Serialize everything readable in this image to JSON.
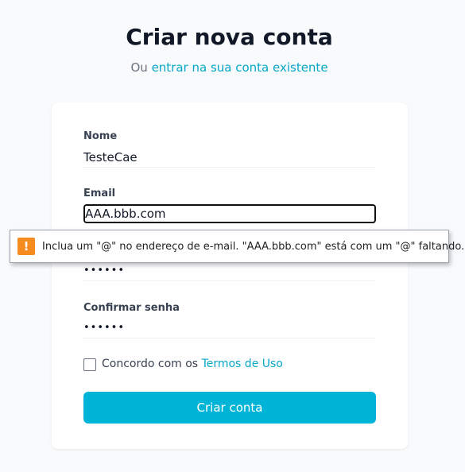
{
  "header": {
    "title": "Criar nova conta",
    "subtitle_prefix": "Ou",
    "subtitle_link": "entrar na sua conta existente"
  },
  "form": {
    "name_label": "Nome",
    "name_value": "TesteCae",
    "email_label": "Email",
    "email_value": "AAA.bbb.com",
    "password_value": "••••••",
    "confirm_label": "Confirmar senha",
    "confirm_value": "••••••",
    "terms_prefix": "Concordo com os",
    "terms_link": "Termos de Uso",
    "terms_checked": false,
    "submit_label": "Criar conta"
  },
  "validation": {
    "icon": "warning-icon",
    "icon_glyph": "!",
    "message": "Inclua um \"@\" no endereço de e-mail. \"AAA.bbb.com\" está com um \"@\" faltando."
  },
  "colors": {
    "accent": "#00b4d8",
    "link": "#06a7c7",
    "warning": "#f68b1f"
  }
}
